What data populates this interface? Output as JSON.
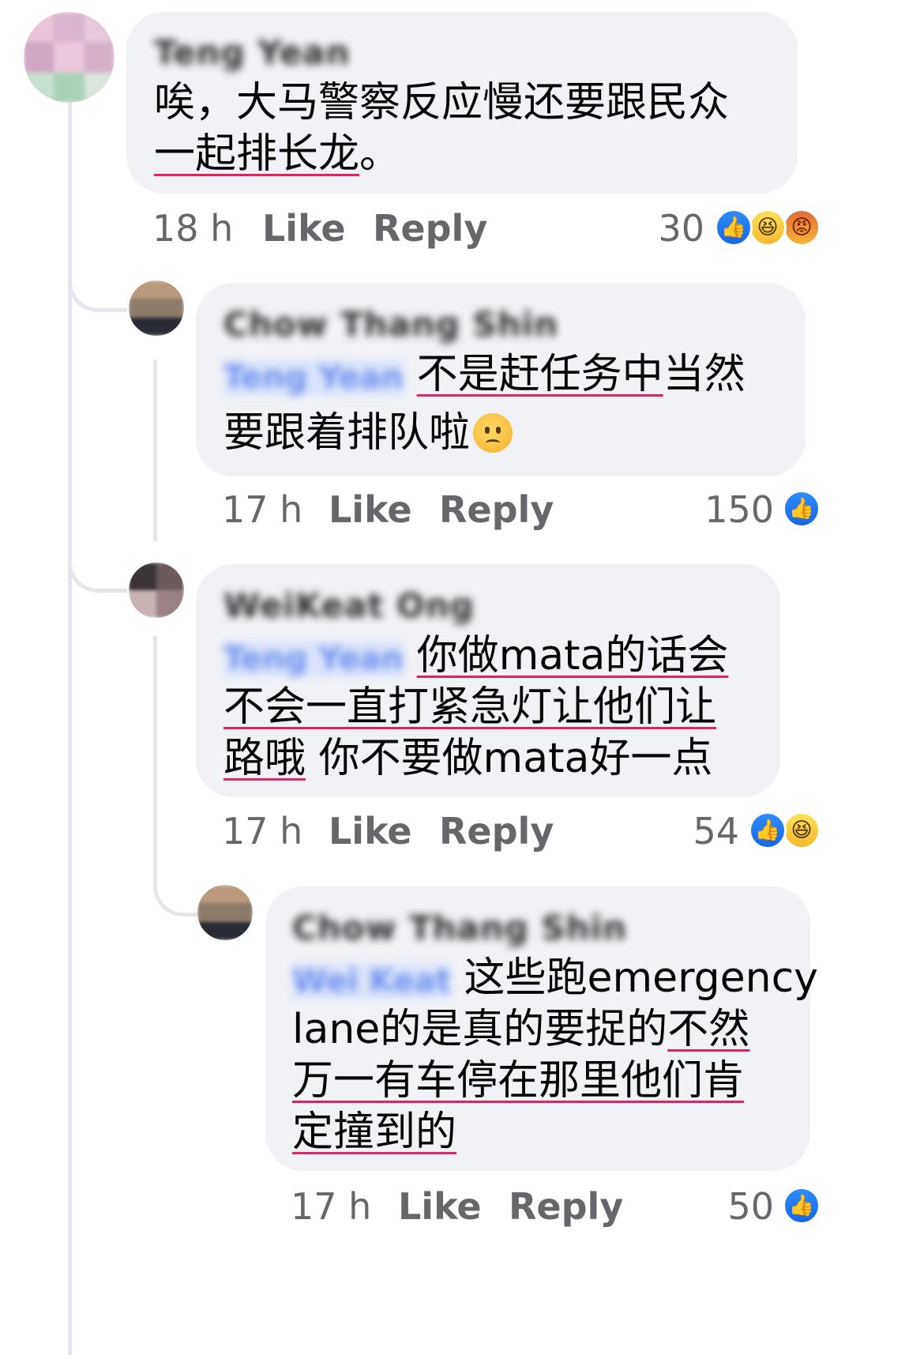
{
  "comments": [
    {
      "author": "Teng Yean",
      "text_lines": [
        "唉，大马警察反应慢还要跟民众",
        "一起排长龙",
        "。"
      ],
      "time": "18 h",
      "like_label": "Like",
      "reply_label": "Reply",
      "reaction_count": "30",
      "reactions": [
        "like-icon",
        "haha-icon",
        "angry-icon"
      ]
    },
    {
      "author": "Chow Thang Shin",
      "mention": "Teng Yean",
      "text_lines": [
        "不是赶任务中",
        "当然",
        "要跟着排队啦"
      ],
      "time": "17 h",
      "like_label": "Like",
      "reply_label": "Reply",
      "reaction_count": "150",
      "reactions": [
        "like-icon"
      ]
    },
    {
      "author": "WeiKeat Ong",
      "mention": "Teng Yean",
      "text_lines": [
        "你做mata的话会",
        "不会一直打紧急灯让他们让",
        "路哦",
        " 你不要做mata好一点"
      ],
      "time": "17 h",
      "like_label": "Like",
      "reply_label": "Reply",
      "reaction_count": "54",
      "reactions": [
        "like-icon",
        "haha-icon"
      ]
    },
    {
      "author": "Chow Thang Shin",
      "mention": "Wei Keat",
      "text_lines": [
        "这些跑emergency",
        "lane的是真的要捉的",
        "不然",
        "万一有车停在那里他们肯",
        "定撞到的"
      ],
      "time": "17 h",
      "like_label": "Like",
      "reply_label": "Reply",
      "reaction_count": "50",
      "reactions": [
        "like-icon"
      ]
    }
  ],
  "colors": {
    "bubble": "#f0f2f5",
    "meta_text": "#65676b",
    "underline": "#e0245e",
    "like_blue": "#1877f2",
    "thread_line": "#e4e6eb"
  }
}
